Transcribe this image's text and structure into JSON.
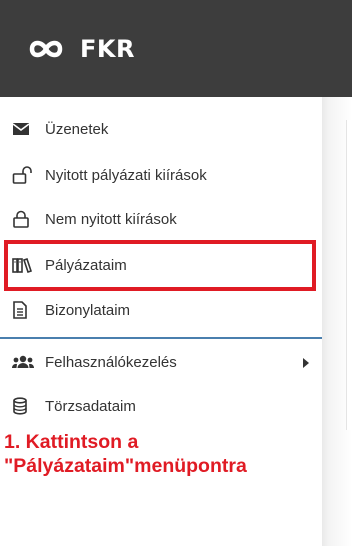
{
  "header": {
    "app_title": "FKR",
    "logo_icon": "infinity-logo-icon",
    "background": "#3d3d3d"
  },
  "sidebar": {
    "items": [
      {
        "label": "Üzenetek",
        "icon": "envelope-icon"
      },
      {
        "label": "Nyitott pályázati kiírások",
        "icon": "unlock-icon"
      },
      {
        "label": "Nem nyitott kiírások",
        "icon": "lock-icon"
      },
      {
        "label": "Pályázataim",
        "icon": "books-icon"
      },
      {
        "label": "Bizonylataim",
        "icon": "document-icon"
      },
      {
        "label": "Felhasználókezelés",
        "icon": "users-icon",
        "has_submenu": true
      },
      {
        "label": "Törzsadataim",
        "icon": "database-icon"
      }
    ],
    "divider_color": "#4a7fae"
  },
  "annotation": {
    "line1": "1. Kattintson a",
    "line2": "\"Pályázataim\"menüpontra",
    "color": "#e01b24"
  }
}
